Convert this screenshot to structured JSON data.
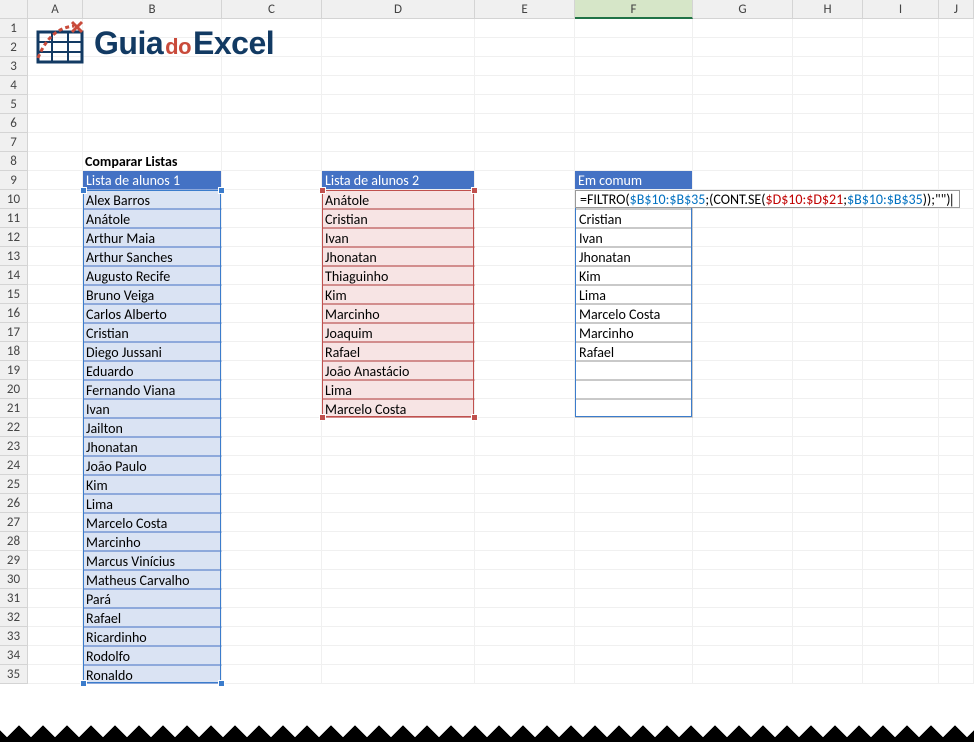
{
  "columns": [
    "A",
    "B",
    "C",
    "D",
    "E",
    "F",
    "G",
    "H",
    "I",
    "J"
  ],
  "rowCount": 35,
  "logo": {
    "text1": "Guia",
    "text2": "do",
    "text3": "Excel"
  },
  "title": "Comparar Listas",
  "list1": {
    "header": "Lista de alunos 1",
    "items": [
      "Alex Barros",
      "Anátole",
      "Arthur Maia",
      "Arthur Sanches",
      "Augusto Recife",
      "Bruno Veiga",
      "Carlos Alberto",
      "Cristian",
      "Diego Jussani",
      "Eduardo",
      "Fernando Viana",
      "Ivan",
      "Jailton",
      "Jhonatan",
      "João Paulo",
      "Kim",
      "Lima",
      "Marcelo Costa",
      "Marcinho",
      "Marcus Vinícius",
      "Matheus Carvalho",
      "Pará",
      "Rafael",
      "Ricardinho",
      "Rodolfo",
      "Ronaldo"
    ]
  },
  "list2": {
    "header": "Lista de alunos 2",
    "items": [
      "Anátole",
      "Cristian",
      "Ivan",
      "Jhonatan",
      "Thiaguinho",
      "Kim",
      "Marcinho",
      "Joaquim",
      "Rafael",
      "João Anastácio",
      "Lima",
      "Marcelo Costa"
    ]
  },
  "list3": {
    "header": "Em comum",
    "items": [
      "Cristian",
      "Ivan",
      "Jhonatan",
      "Kim",
      "Lima",
      "Marcelo Costa",
      "Marcinho",
      "Rafael"
    ]
  },
  "formula": {
    "parts": [
      {
        "t": "=FILTRO(",
        "c": "black"
      },
      {
        "t": "$B$10:$B$35",
        "c": "blue"
      },
      {
        "t": ";(CONT.SE(",
        "c": "black"
      },
      {
        "t": "$D$10:$D$21",
        "c": "red"
      },
      {
        "t": ";",
        "c": "black"
      },
      {
        "t": "$B$10:$B$35",
        "c": "blue"
      },
      {
        "t": "));\"\")",
        "c": "black"
      }
    ]
  },
  "chart_data": {
    "type": "table",
    "title": "Comparar Listas",
    "series": [
      {
        "name": "Lista de alunos 1",
        "values": [
          "Alex Barros",
          "Anátole",
          "Arthur Maia",
          "Arthur Sanches",
          "Augusto Recife",
          "Bruno Veiga",
          "Carlos Alberto",
          "Cristian",
          "Diego Jussani",
          "Eduardo",
          "Fernando Viana",
          "Ivan",
          "Jailton",
          "Jhonatan",
          "João Paulo",
          "Kim",
          "Lima",
          "Marcelo Costa",
          "Marcinho",
          "Marcus Vinícius",
          "Matheus Carvalho",
          "Pará",
          "Rafael",
          "Ricardinho",
          "Rodolfo",
          "Ronaldo"
        ]
      },
      {
        "name": "Lista de alunos 2",
        "values": [
          "Anátole",
          "Cristian",
          "Ivan",
          "Jhonatan",
          "Thiaguinho",
          "Kim",
          "Marcinho",
          "Joaquim",
          "Rafael",
          "João Anastácio",
          "Lima",
          "Marcelo Costa"
        ]
      },
      {
        "name": "Em comum",
        "values": [
          "Cristian",
          "Ivan",
          "Jhonatan",
          "Kim",
          "Lima",
          "Marcelo Costa",
          "Marcinho",
          "Rafael"
        ]
      }
    ]
  }
}
